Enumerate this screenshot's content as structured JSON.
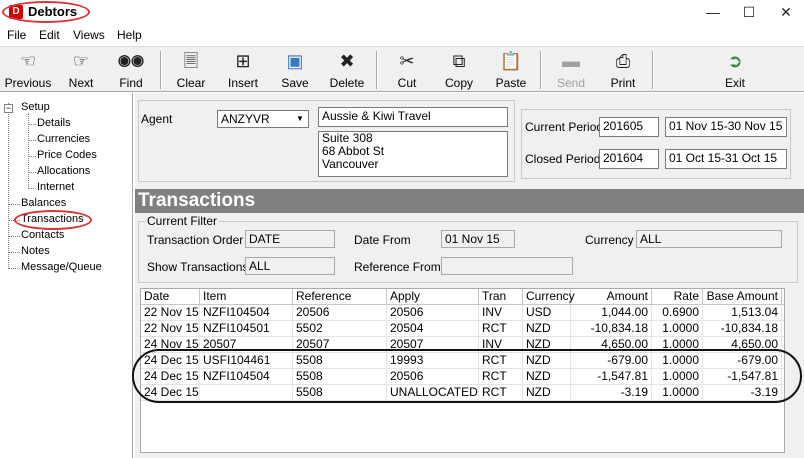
{
  "window": {
    "title": "Debtors",
    "icon_letter": "D"
  },
  "menu": [
    "File",
    "Edit",
    "Views",
    "Help"
  ],
  "toolbar": {
    "previous": "Previous",
    "next": "Next",
    "find": "Find",
    "clear": "Clear",
    "insert": "Insert",
    "save": "Save",
    "delete": "Delete",
    "cut": "Cut",
    "copy": "Copy",
    "paste": "Paste",
    "send": "Send",
    "print": "Print",
    "exit": "Exit"
  },
  "tree": {
    "setup": "Setup",
    "children": [
      "Details",
      "Currencies",
      "Price Codes",
      "Allocations",
      "Internet"
    ],
    "balances": "Balances",
    "transactions": "Transactions",
    "contacts": "Contacts",
    "notes": "Notes",
    "message_queue": "Message/Queue"
  },
  "agent": {
    "label": "Agent",
    "code": "ANZYVR",
    "name": "Aussie & Kiwi Travel",
    "address_line1": "Suite 308",
    "address_line2": "68 Abbot St",
    "address_line3": "Vancouver"
  },
  "periods": {
    "current_label": "Current Period",
    "current_code": "201605",
    "current_range": "01 Nov 15-30 Nov 15",
    "closed_label": "Closed Period",
    "closed_code": "201604",
    "closed_range": "01 Oct 15-31 Oct 15"
  },
  "transactions_title": "Transactions",
  "filter": {
    "legend": "Current Filter",
    "order_label": "Transaction Order",
    "order_value": "DATE",
    "date_from_label": "Date From",
    "date_from_value": "01 Nov 15",
    "currency_label": "Currency",
    "currency_value": "ALL",
    "show_label": "Show Transactions",
    "show_value": "ALL",
    "ref_from_label": "Reference From",
    "ref_from_value": ""
  },
  "grid": {
    "columns": [
      "Date",
      "Item",
      "Reference",
      "Apply",
      "Tran",
      "Currency",
      "Amount",
      "Rate",
      "Base Amount"
    ],
    "rows": [
      [
        "22 Nov 15",
        "NZFI104504",
        "20506",
        "20506",
        "INV",
        "USD",
        "1,044.00",
        "0.6900",
        "1,513.04"
      ],
      [
        "22 Nov 15",
        "NZFI104501",
        "5502",
        "20504",
        "RCT",
        "NZD",
        "-10,834.18",
        "1.0000",
        "-10,834.18"
      ],
      [
        "24 Nov 15",
        "20507",
        "20507",
        "20507",
        "INV",
        "NZD",
        "4,650.00",
        "1.0000",
        "4,650.00"
      ],
      [
        "24 Dec 15",
        "USFI104461",
        "5508",
        "19993",
        "RCT",
        "NZD",
        "-679.00",
        "1.0000",
        "-679.00"
      ],
      [
        "24 Dec 15",
        "NZFI104504",
        "5508",
        "20506",
        "RCT",
        "NZD",
        "-1,547.81",
        "1.0000",
        "-1,547.81"
      ],
      [
        "24 Dec 15",
        "",
        "5508",
        "UNALLOCATED",
        "RCT",
        "NZD",
        "-3.19",
        "1.0000",
        "-3.19"
      ]
    ]
  }
}
